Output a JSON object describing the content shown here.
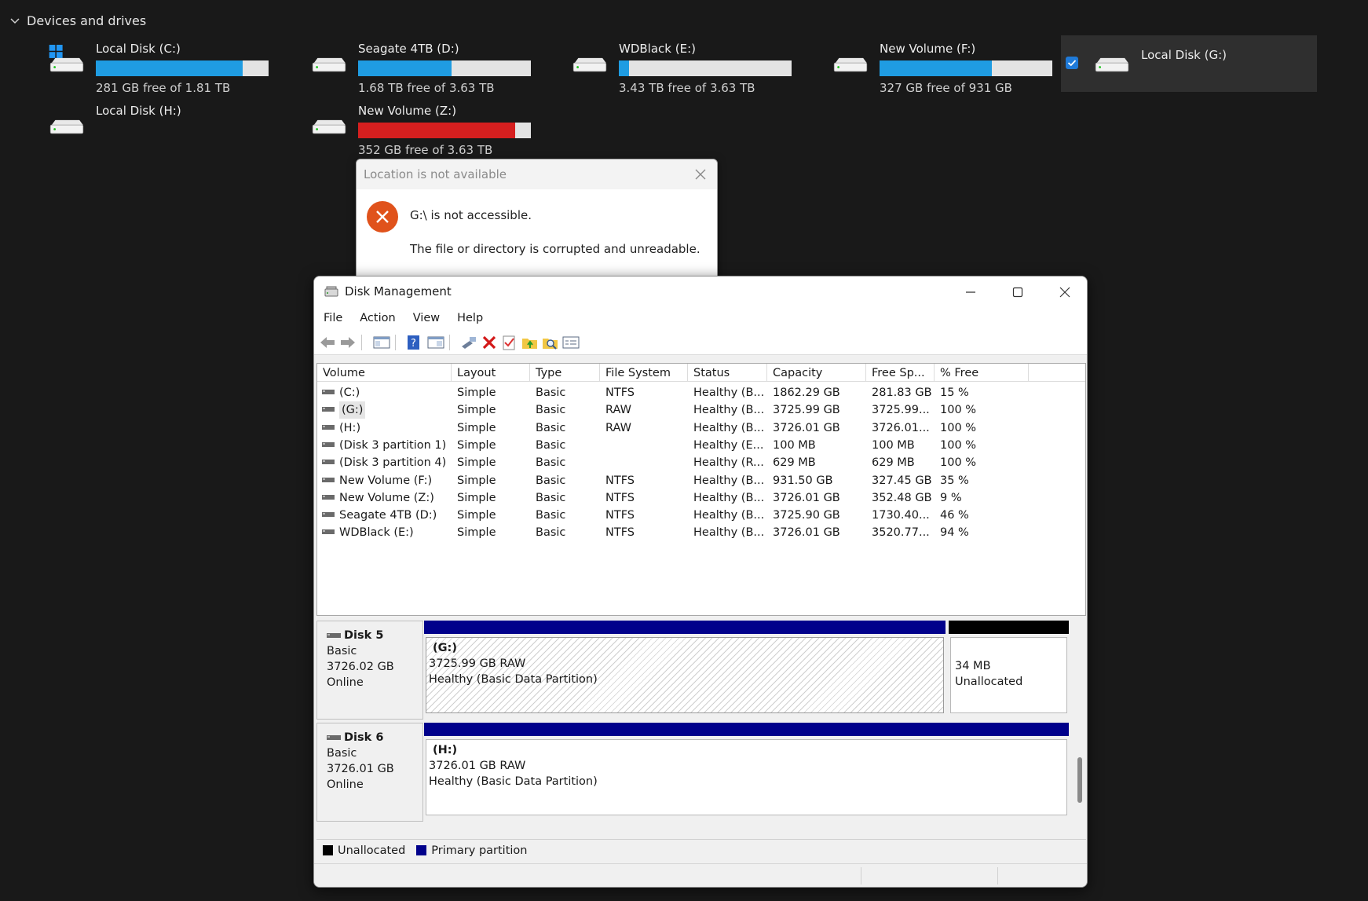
{
  "explorer": {
    "section_title": "Devices and drives",
    "drives": [
      {
        "name": "Local Disk (C:)",
        "free_text": "281 GB free of 1.81 TB",
        "used_fraction": 0.85,
        "color": "#1f9ce2"
      },
      {
        "name": "Seagate 4TB (D:)",
        "free_text": "1.68 TB free of 3.63 TB",
        "used_fraction": 0.54,
        "color": "#1f9ce2"
      },
      {
        "name": "WDBlack (E:)",
        "free_text": "3.43 TB free of 3.63 TB",
        "used_fraction": 0.06,
        "color": "#1f9ce2"
      },
      {
        "name": "New Volume (F:)",
        "free_text": "327 GB free of 931 GB",
        "used_fraction": 0.65,
        "color": "#1f9ce2"
      },
      {
        "name": "Local Disk (G:)",
        "free_text": "",
        "used_fraction": null,
        "selected": true
      },
      {
        "name": "Local Disk (H:)",
        "free_text": "",
        "used_fraction": null
      },
      {
        "name": "New Volume (Z:)",
        "free_text": "352 GB free of 3.63 TB",
        "used_fraction": 0.91,
        "color": "#d61f1f"
      }
    ]
  },
  "error_dialog": {
    "title": "Location is not available",
    "message": "G:\\ is not accessible.",
    "detail": "The file or directory is corrupted and unreadable.",
    "icon": "error-x-icon",
    "accent": "#e0521b"
  },
  "disk_management": {
    "title": "Disk Management",
    "menu": [
      "File",
      "Action",
      "View",
      "Help"
    ],
    "toolbar_icons": [
      "back-arrow-icon",
      "forward-arrow-icon",
      "console-tree-icon",
      "help-icon",
      "properties-view-icon",
      "connect-icon",
      "delete-icon",
      "check-icon",
      "folder-up-icon",
      "folder-search-icon",
      "properties-icon"
    ],
    "columns": [
      "Volume",
      "Layout",
      "Type",
      "File System",
      "Status",
      "Capacity",
      "Free Sp...",
      "% Free"
    ],
    "volumes": [
      {
        "volume": "(C:)",
        "layout": "Simple",
        "type": "Basic",
        "fs": "NTFS",
        "status": "Healthy (B...",
        "capacity": "1862.29 GB",
        "free": "281.83 GB",
        "pct": "15 %"
      },
      {
        "volume": "(G:)",
        "layout": "Simple",
        "type": "Basic",
        "fs": "RAW",
        "status": "Healthy (B...",
        "capacity": "3725.99 GB",
        "free": "3725.99...",
        "pct": "100 %",
        "selected": true
      },
      {
        "volume": "(H:)",
        "layout": "Simple",
        "type": "Basic",
        "fs": "RAW",
        "status": "Healthy (B...",
        "capacity": "3726.01 GB",
        "free": "3726.01...",
        "pct": "100 %"
      },
      {
        "volume": "(Disk 3 partition 1)",
        "layout": "Simple",
        "type": "Basic",
        "fs": "",
        "status": "Healthy (E...",
        "capacity": "100 MB",
        "free": "100 MB",
        "pct": "100 %"
      },
      {
        "volume": "(Disk 3 partition 4)",
        "layout": "Simple",
        "type": "Basic",
        "fs": "",
        "status": "Healthy (R...",
        "capacity": "629 MB",
        "free": "629 MB",
        "pct": "100 %"
      },
      {
        "volume": "New Volume (F:)",
        "layout": "Simple",
        "type": "Basic",
        "fs": "NTFS",
        "status": "Healthy (B...",
        "capacity": "931.50 GB",
        "free": "327.45 GB",
        "pct": "35 %"
      },
      {
        "volume": "New Volume (Z:)",
        "layout": "Simple",
        "type": "Basic",
        "fs": "NTFS",
        "status": "Healthy (B...",
        "capacity": "3726.01 GB",
        "free": "352.48 GB",
        "pct": "9 %"
      },
      {
        "volume": "Seagate 4TB (D:)",
        "layout": "Simple",
        "type": "Basic",
        "fs": "NTFS",
        "status": "Healthy (B...",
        "capacity": "3725.90 GB",
        "free": "1730.40...",
        "pct": "46 %"
      },
      {
        "volume": "WDBlack (E:)",
        "layout": "Simple",
        "type": "Basic",
        "fs": "NTFS",
        "status": "Healthy (B...",
        "capacity": "3726.01 GB",
        "free": "3520.77...",
        "pct": "94 %"
      }
    ],
    "disks": [
      {
        "name": "Disk 5",
        "kind": "Basic",
        "size": "3726.02 GB",
        "state": "Online",
        "partitions": [
          {
            "label": "(G:)",
            "line1": "3725.99 GB RAW",
            "line2": "Healthy (Basic Data Partition)",
            "kind": "primary"
          },
          {
            "label": "",
            "line1": "34 MB",
            "line2": "Unallocated",
            "kind": "unallocated"
          }
        ]
      },
      {
        "name": "Disk 6",
        "kind": "Basic",
        "size": "3726.01 GB",
        "state": "Online",
        "partitions": [
          {
            "label": "(H:)",
            "line1": "3726.01 GB RAW",
            "line2": "Healthy (Basic Data Partition)",
            "kind": "primary"
          }
        ]
      }
    ],
    "legend": [
      {
        "label": "Unallocated",
        "color": "#000000"
      },
      {
        "label": "Primary partition",
        "color": "#00008b"
      }
    ]
  }
}
